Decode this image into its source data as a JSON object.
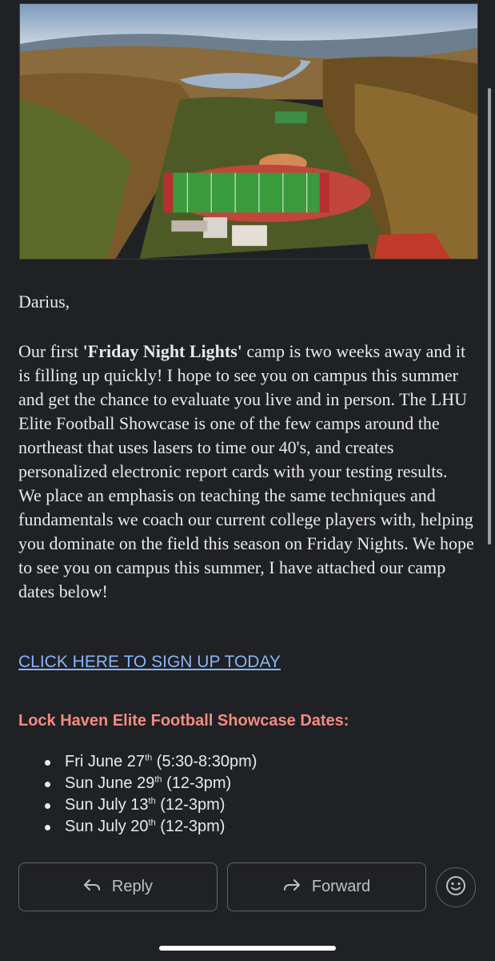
{
  "email": {
    "greeting": "Darius,",
    "paragraph": {
      "part1": "Our first ",
      "camp_name": "'Friday Night Lights'",
      "part2": " camp is two weeks away and it is filling up quickly! I hope to see you on campus this summer and get the chance to evaluate you live and in person. The LHU Elite Football Showcase is one of the few camps around the northeast that uses lasers to time our 40's, and creates personalized electronic report cards with your testing results. We place an emphasis on teaching the same techniques and fundamentals we coach our current college players with, helping you dominate on the field this season on Friday Nights. We hope to see you on campus this summer, I have attached our camp dates below!"
    },
    "signup_link": "CLICK HERE TO SIGN UP TODAY",
    "dates_heading": "Lock Haven Elite Football Showcase Dates:",
    "dates": [
      {
        "prefix": "Fri June 27",
        "suffix": "th",
        "time": " (5:30-8:30pm)"
      },
      {
        "prefix": "Sun June 29",
        "suffix": "th",
        "time": " (12-3pm)"
      },
      {
        "prefix": "Sun July 13",
        "suffix": "th",
        "time": " (12-3pm)"
      },
      {
        "prefix": "Sun July 20",
        "suffix": "th",
        "time": " (12-3pm)"
      }
    ]
  },
  "actions": {
    "reply_label": "Reply",
    "forward_label": "Forward"
  },
  "icons": {
    "reply": "reply-arrow-icon",
    "forward": "forward-arrow-icon",
    "emoji": "smiley-face-icon"
  },
  "colors": {
    "background": "#202124",
    "link": "#8ab4f8",
    "heading_accent": "#f28b82",
    "text": "#e8eaed"
  }
}
